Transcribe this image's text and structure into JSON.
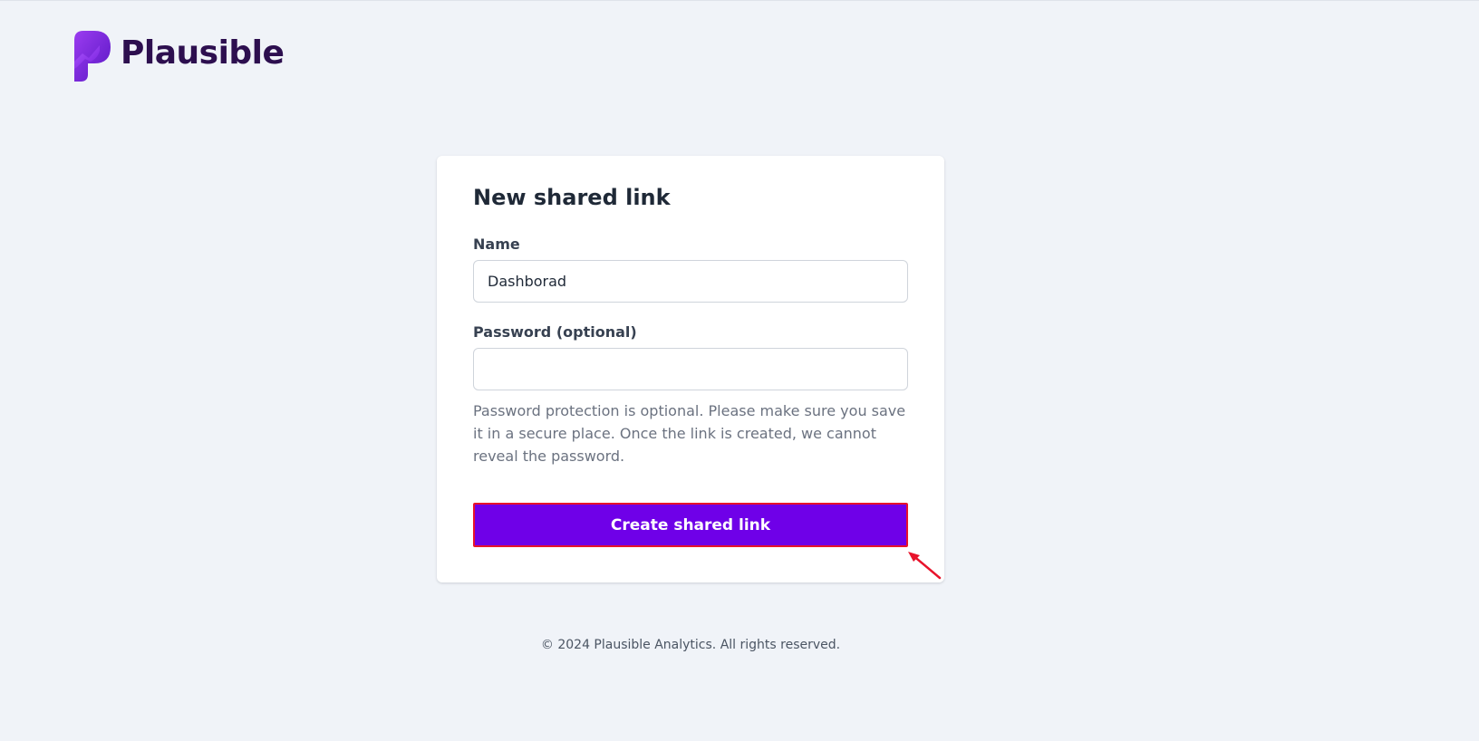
{
  "brand": {
    "name": "Plausible",
    "logo_icon": "plausible-logo-icon",
    "color": "#2d0f4f"
  },
  "form": {
    "title": "New shared link",
    "name_field": {
      "label": "Name",
      "value": "Dashborad"
    },
    "password_field": {
      "label": "Password (optional)",
      "value": ""
    },
    "help_text": "Password protection is optional. Please make sure you save it in a secure place. Once the link is created, we cannot reveal the password.",
    "submit_label": "Create shared link"
  },
  "footer": {
    "text": "© 2024 Plausible Analytics. All rights reserved."
  },
  "colors": {
    "accent": "#6f00e8",
    "highlight": "#e8132b",
    "background": "#f0f3f8"
  },
  "annotation": {
    "icon": "red-arrow-icon"
  }
}
